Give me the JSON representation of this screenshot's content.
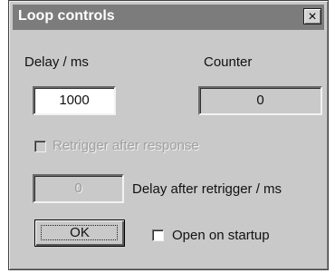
{
  "window": {
    "title": "Loop controls",
    "close_glyph": "×"
  },
  "delay": {
    "label": "Delay / ms",
    "value": "1000"
  },
  "counter": {
    "label": "Counter",
    "value": "0"
  },
  "retrigger": {
    "label": "Retrigger after response",
    "checked": false,
    "enabled": false
  },
  "retrigger_delay": {
    "value": "0",
    "label": "Delay after retrigger / ms"
  },
  "buttons": {
    "ok_label": "OK"
  },
  "startup": {
    "label": "Open on startup",
    "checked": false
  }
}
